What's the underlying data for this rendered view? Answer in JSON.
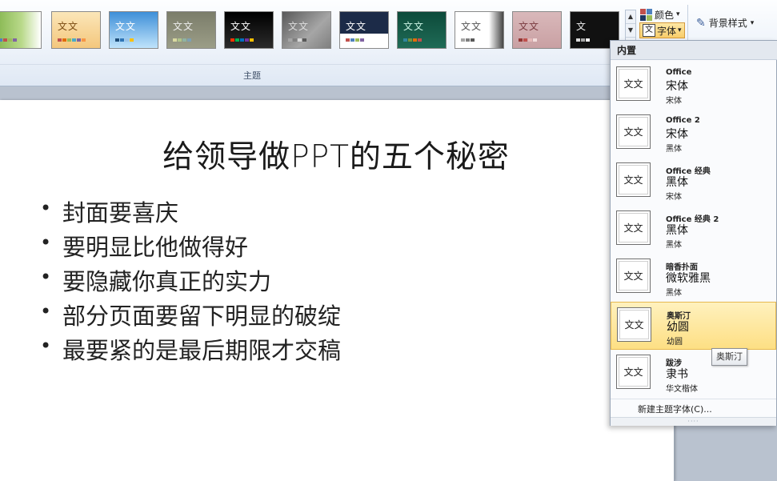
{
  "ribbon": {
    "group_label": "主题",
    "themes": [
      {
        "name": "theme-1",
        "text": "",
        "bg": "linear-gradient(90deg,#7fb248,#b9d98a 60%,#ffffff)",
        "fg": "#fff",
        "swatch": [
          "#4f81bd",
          "#c0504d",
          "#9bbb59",
          "#8064a2"
        ]
      },
      {
        "name": "theme-2",
        "text": "文文",
        "bg": "linear-gradient(#fbe6b8,#f4c77d)",
        "fg": "#7a4b12",
        "swatch": [
          "#c0504d",
          "#e36c09",
          "#9bbb59",
          "#4bacc6",
          "#8064a2",
          "#f79646"
        ]
      },
      {
        "name": "theme-3",
        "text": "文文",
        "bg": "linear-gradient(#3e8fd8,#bfe3fb)",
        "fg": "#fff",
        "swatch": [
          "#1f4e79",
          "#2e75b6",
          "#9dc3e6",
          "#ffc000"
        ]
      },
      {
        "name": "theme-4",
        "text": "文文",
        "bg": "linear-gradient(#7b7d6a,#9b9d87)",
        "fg": "#eee",
        "swatch": [
          "#d9d9a0",
          "#b0c48a",
          "#8fb3a1",
          "#7da0b4"
        ]
      },
      {
        "name": "theme-5",
        "text": "文文",
        "bg": "linear-gradient(#000000,#2b2b2b)",
        "fg": "#fff",
        "swatch": [
          "#ff3300",
          "#00b050",
          "#0070c0",
          "#7030a0",
          "#ffc000"
        ]
      },
      {
        "name": "theme-6",
        "text": "文文",
        "bg": "linear-gradient(135deg,#595959,#a6a6a6 60%,#7f7f7f)",
        "fg": "#ddd",
        "swatch": [
          "#a5a5a5",
          "#7f7f7f",
          "#d9d9d9",
          "#595959"
        ]
      },
      {
        "name": "theme-7",
        "text": "文文",
        "bg": "linear-gradient(#1c2b48 60%,#ffffff 60%)",
        "fg": "#fff",
        "swatch": [
          "#c0504d",
          "#4f81bd",
          "#9bbb59",
          "#8064a2"
        ]
      },
      {
        "name": "theme-8",
        "text": "文文",
        "bg": "linear-gradient(#0d4a3a,#1f6b56)",
        "fg": "#c9f2e3",
        "swatch": [
          "#31859c",
          "#76923c",
          "#e36c09",
          "#c0504d"
        ]
      },
      {
        "name": "theme-9",
        "text": "文文",
        "bg": "linear-gradient(90deg,#ffffff 70%,#444 100%)",
        "fg": "#555",
        "swatch": [
          "#a5a5a5",
          "#7f7f7f",
          "#595959"
        ]
      },
      {
        "name": "theme-10",
        "text": "文文",
        "bg": "linear-gradient(#d9b8ba,#c9a0a3)",
        "fg": "#7a3b40",
        "swatch": [
          "#943634",
          "#c0504d",
          "#e6b9b8",
          "#f2dcdb"
        ]
      },
      {
        "name": "theme-11",
        "text": "文",
        "bg": "#111111",
        "fg": "#eee",
        "swatch": [
          "#d9d9d9",
          "#a6a6a6",
          "#f2f2f2"
        ]
      }
    ],
    "colors_label": "颜色",
    "fonts_label": "字体",
    "background_label": "背景样式",
    "icons": {
      "scroll_up": "▲",
      "scroll_down": "▼",
      "scroll_more": "▾",
      "dropdown_arrow": "▾",
      "background": "✎"
    }
  },
  "slide": {
    "title": "给领导做PPT的五个秘密",
    "bullets": [
      "封面要喜庆",
      "要明显比他做得好",
      "要隐藏你真正的实力",
      "部分页面要留下明显的破绽",
      "最要紧的是最后期限才交稿"
    ]
  },
  "fonts_menu": {
    "header": "内置",
    "items": [
      {
        "name": "Office",
        "heading": "宋体",
        "body": "宋体",
        "sample": "文文",
        "selected": false
      },
      {
        "name": "Office 2",
        "heading": "宋体",
        "body": "黑体",
        "sample": "文文",
        "selected": false
      },
      {
        "name": "Office 经典",
        "heading": "黑体",
        "body": "宋体",
        "sample": "文文",
        "selected": false
      },
      {
        "name": "Office 经典 2",
        "heading": "黑体",
        "body": "黑体",
        "sample": "文文",
        "selected": false
      },
      {
        "name": "暗香扑面",
        "heading": "微软雅黑",
        "body": "黑体",
        "sample": "文文",
        "selected": false
      },
      {
        "name": "奥斯汀",
        "heading": "幼圆",
        "body": "幼圆",
        "sample": "文文",
        "selected": true
      },
      {
        "name": "跋涉",
        "heading": "隶书",
        "body": "华文楷体",
        "sample": "文文",
        "selected": false
      }
    ],
    "new_font_label": "新建主题字体(C)...",
    "grip": "····",
    "tooltip": "奥斯汀"
  }
}
